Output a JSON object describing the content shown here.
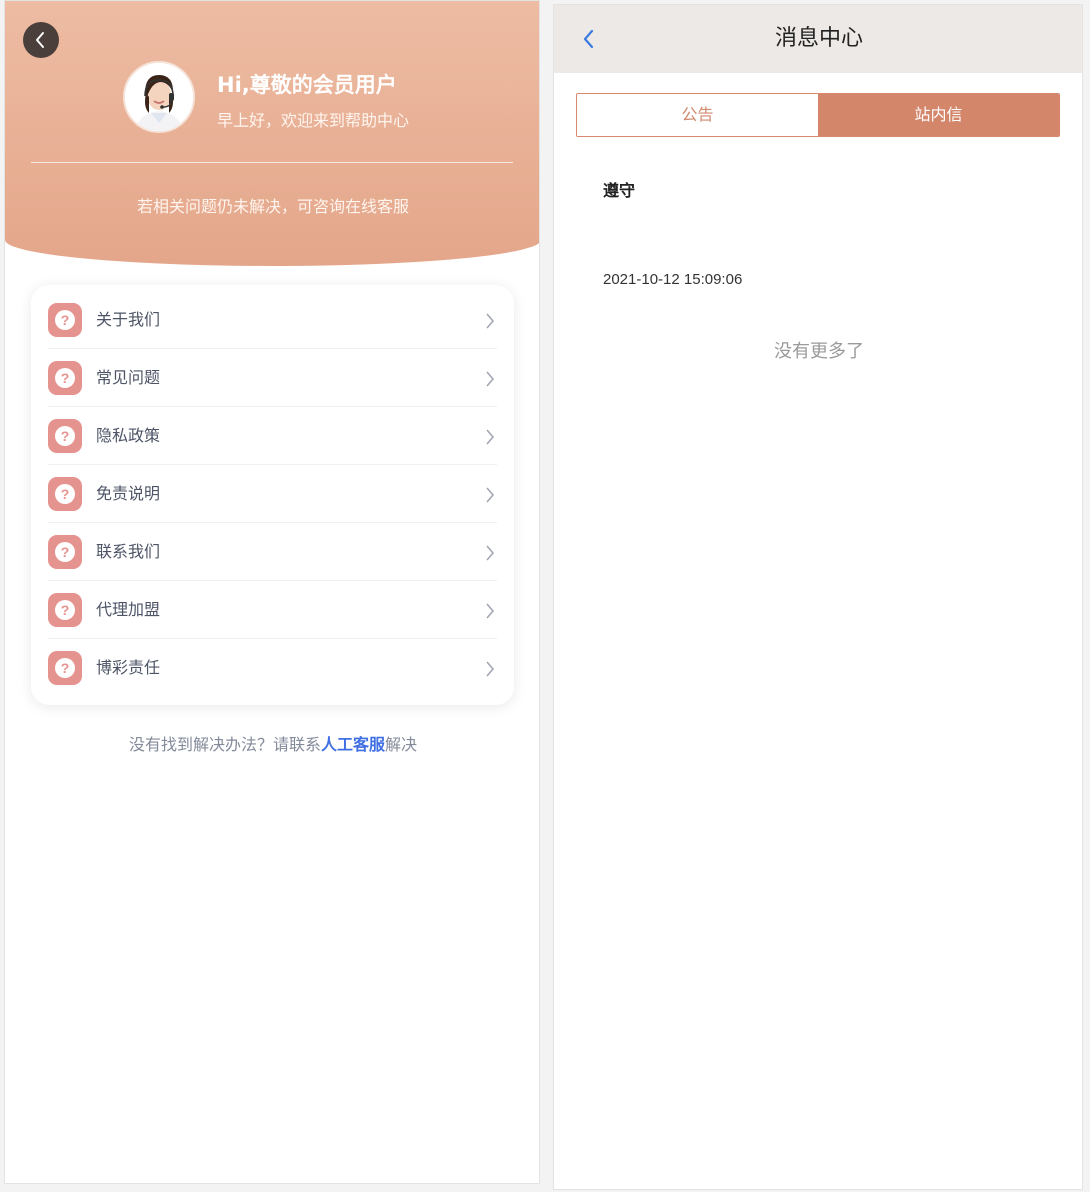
{
  "left_panel": {
    "greeting_title": "Hi,尊敬的会员用户",
    "greeting_subtitle": "早上好，欢迎来到帮助中心",
    "hero_note": "若相关问题仍未解决，可咨询在线客服",
    "menu_items": [
      {
        "label": "关于我们",
        "icon": "question-icon"
      },
      {
        "label": "常见问题",
        "icon": "question-icon"
      },
      {
        "label": "隐私政策",
        "icon": "question-icon"
      },
      {
        "label": "免责说明",
        "icon": "question-icon"
      },
      {
        "label": "联系我们",
        "icon": "question-icon"
      },
      {
        "label": "代理加盟",
        "icon": "question-icon"
      },
      {
        "label": "博彩责任",
        "icon": "question-icon"
      }
    ],
    "footer": {
      "prefix": "没有找到解决办法？请联系",
      "link": "人工客服",
      "suffix": "解决"
    }
  },
  "right_panel": {
    "title": "消息中心",
    "tabs": [
      {
        "label": "公告",
        "active": false
      },
      {
        "label": "站内信",
        "active": true
      }
    ],
    "message": {
      "title": "遵守",
      "time": "2021-10-12 15:09:06"
    },
    "no_more_text": "没有更多了"
  },
  "colors": {
    "hero_gradient_top": "#edbca3",
    "hero_gradient_bottom": "#e4a68a",
    "accent": "#d4866b",
    "menu_icon_bg": "#e5938e",
    "link": "#3f6fe2",
    "back_arrow_blue": "#3a7be0"
  }
}
